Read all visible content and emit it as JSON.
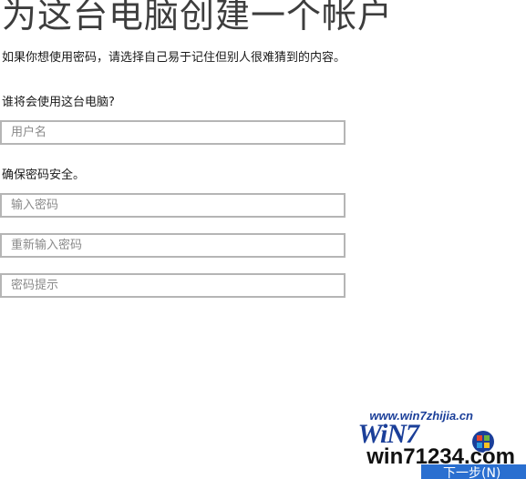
{
  "header": {
    "title": "为这台电脑创建一个帐户"
  },
  "description": "如果你想使用密码，请选择自己易于记住但别人很难猜到的内容。",
  "user_section": {
    "label": "谁将会使用这台电脑?",
    "username_placeholder": "用户名"
  },
  "password_section": {
    "label": "确保密码安全。",
    "password_placeholder": "输入密码",
    "confirm_placeholder": "重新输入密码",
    "hint_placeholder": "密码提示"
  },
  "footer": {
    "next_label": "下一步(N)"
  },
  "watermark": {
    "url": "www.win7zhijia.cn",
    "logo": "WiN7",
    "domain": "win71234.com"
  },
  "colors": {
    "field_border": "#b5b5b5",
    "placeholder": "#8a8a8a",
    "accent": "#2a6fd0",
    "watermark_blue": "#1b3f99"
  }
}
